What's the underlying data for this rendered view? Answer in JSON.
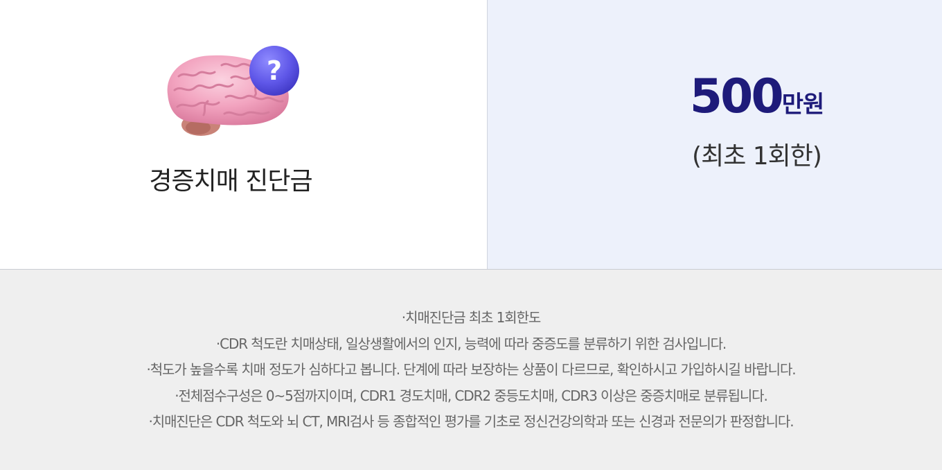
{
  "benefit": {
    "title": "경증치매 진단금",
    "illustration_icon": "brain-question-icon",
    "amount_number": "500",
    "amount_unit": "만원",
    "amount_note": "(최초 1회한)"
  },
  "notes": {
    "bullet": "·",
    "items": [
      "치매진단금 최초 1회한도",
      "CDR 척도란 치매상태, 일상생활에서의 인지, 능력에 따라 중증도를 분류하기 위한 검사입니다.",
      "척도가 높을수록 치매 정도가 심하다고 봅니다.  단계에 따라 보장하는 상품이 다르므로, 확인하시고 가입하시길 바랍니다.",
      "전체점수구성은 0~5점까지이며, CDR1 경도치매, CDR2 중등도치매, CDR3 이상은 중증치매로 분류됩니다.",
      "치매진단은 CDR 척도와 뇌 CT, MRI검사 등 종합적인 평가를 기초로 정신건강의학과 또는 신경과 전문의가 판정합니다."
    ]
  },
  "colors": {
    "amount": "#1e1b7a",
    "right_panel_bg": "#edf1fb",
    "notes_bg": "#efefef",
    "notes_text": "#666666",
    "brain_pink": "#f2a3bf",
    "question_badge": "#5f57e8"
  }
}
